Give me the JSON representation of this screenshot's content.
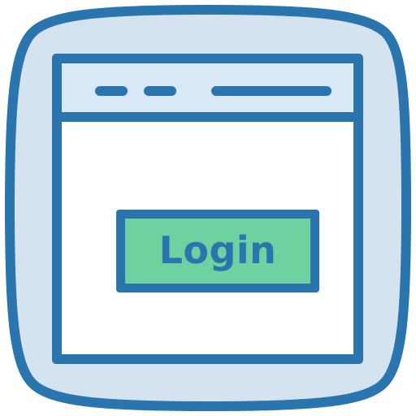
{
  "icon": {
    "name": "browser-login-icon",
    "colors": {
      "outline": "#2a75ad",
      "background_fill": "#d5e3f1",
      "title_bar_fill": "#d8e8f7",
      "window_fill": "#ffffff",
      "button_fill": "#6fd19f"
    }
  },
  "window": {
    "title_bar_elements": [
      "window-dash",
      "window-dash",
      "address-bar-line"
    ]
  },
  "login_button": {
    "label": "Login"
  }
}
